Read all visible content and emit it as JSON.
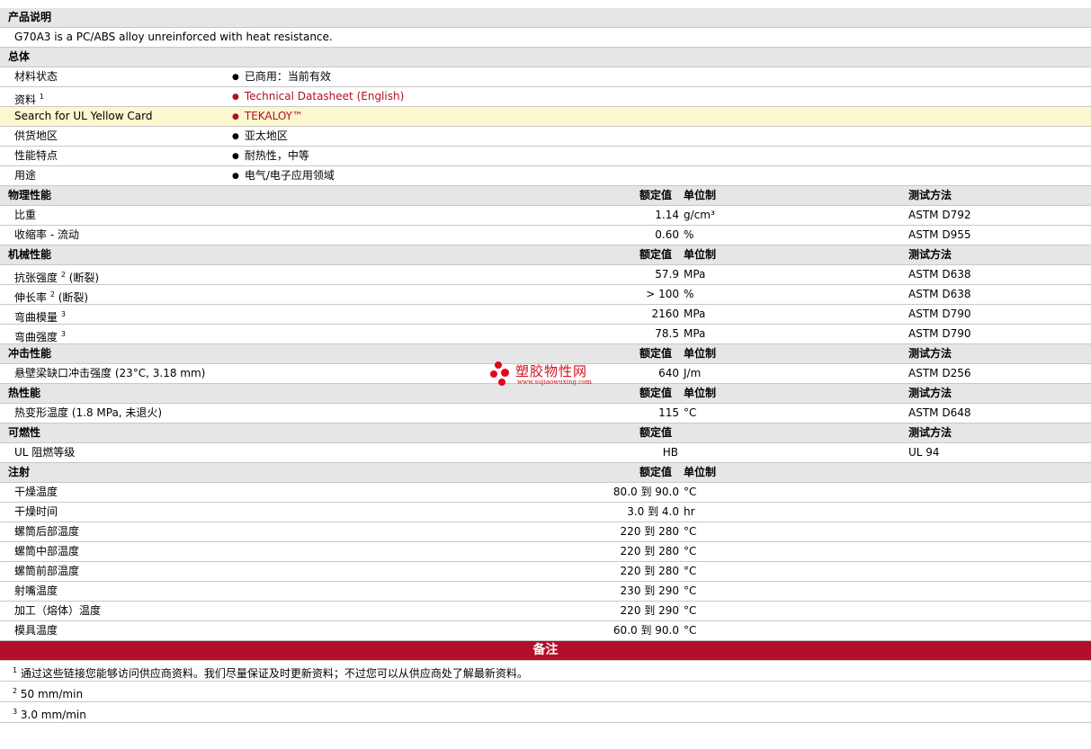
{
  "description": {
    "header": "产品说明",
    "text": "G70A3 is a PC/ABS alloy unreinforced with heat resistance."
  },
  "general": {
    "header": "总体",
    "rows": [
      {
        "label": "材料状态",
        "value": "已商用：当前有效",
        "link": false
      },
      {
        "label": "资料",
        "sup": "1",
        "value": "Technical Datasheet (English)",
        "link": true
      },
      {
        "label": "Search for UL Yellow Card",
        "value": "TEKALOY™",
        "link": true,
        "highlight": true
      },
      {
        "label": "供货地区",
        "value": "亚太地区",
        "link": false
      },
      {
        "label": "性能特点",
        "value": "耐热性，中等",
        "link": false
      },
      {
        "label": "用途",
        "value": "电气/电子应用领域",
        "link": false
      }
    ]
  },
  "col_headers": {
    "nominal": "额定值",
    "unit": "单位制",
    "method": "测试方法"
  },
  "physical": {
    "header": "物理性能",
    "rows": [
      {
        "label": "比重",
        "value": "1.14",
        "unit": "g/cm³",
        "method": "ASTM D792"
      },
      {
        "label": "收缩率  - 流动",
        "value": "0.60",
        "unit": "%",
        "method": "ASTM D955"
      }
    ]
  },
  "mechanical": {
    "header": "机械性能",
    "rows": [
      {
        "label": "抗张强度",
        "sup": "2",
        "suffix": "(断裂)",
        "value": "57.9",
        "unit": "MPa",
        "method": "ASTM D638"
      },
      {
        "label": "伸长率",
        "sup": "2",
        "suffix": "(断裂)",
        "value": "> 100",
        "unit": "%",
        "method": "ASTM D638"
      },
      {
        "label": "弯曲模量",
        "sup": "3",
        "suffix": "",
        "value": "2160",
        "unit": "MPa",
        "method": "ASTM D790"
      },
      {
        "label": "弯曲强度",
        "sup": "3",
        "suffix": "",
        "value": "78.5",
        "unit": "MPa",
        "method": "ASTM D790"
      }
    ]
  },
  "impact": {
    "header": "冲击性能",
    "rows": [
      {
        "label": "悬壁梁缺口冲击强度  (23°C, 3.18 mm)",
        "value": "640",
        "unit": "J/m",
        "method": "ASTM D256"
      }
    ]
  },
  "thermal": {
    "header": "热性能",
    "rows": [
      {
        "label": "热变形温度  (1.8 MPa, 未退火)",
        "value": "115",
        "unit": "°C",
        "method": "ASTM D648"
      }
    ]
  },
  "flammability": {
    "header": "可燃性",
    "rows": [
      {
        "label": "UL 阻燃等级",
        "value": "HB",
        "unit": "",
        "method": "UL 94"
      }
    ]
  },
  "injection": {
    "header": "注射",
    "to": "到",
    "rows": [
      {
        "label": "干燥温度",
        "from": "80.0",
        "upto": "90.0",
        "unit": "°C"
      },
      {
        "label": "干燥时间",
        "from": "3.0",
        "upto": "4.0",
        "unit": "hr"
      },
      {
        "label": "螺筒后部温度",
        "from": "220",
        "upto": "280",
        "unit": "°C"
      },
      {
        "label": "螺筒中部温度",
        "from": "220",
        "upto": "280",
        "unit": "°C"
      },
      {
        "label": "螺筒前部温度",
        "from": "220",
        "upto": "280",
        "unit": "°C"
      },
      {
        "label": "射嘴温度",
        "from": "230",
        "upto": "290",
        "unit": "°C"
      },
      {
        "label": "加工（熔体）温度",
        "from": "220",
        "upto": "290",
        "unit": "°C"
      },
      {
        "label": "模具温度",
        "from": "60.0",
        "upto": "90.0",
        "unit": "°C"
      }
    ]
  },
  "notes": {
    "header": "备注",
    "items": [
      {
        "num": "1",
        "text": "通过这些链接您能够访问供应商资料。我们尽量保证及时更新资料；不过您可以从供应商处了解最新资料。"
      },
      {
        "num": "2",
        "text": "50 mm/min"
      },
      {
        "num": "3",
        "text": "3.0 mm/min"
      }
    ]
  },
  "watermark": {
    "name": "塑胶物性网",
    "url": "www.sujiaowuxing.com"
  },
  "colors": {
    "link": "#b01026",
    "notes_bar": "#b10f2a",
    "header_bg": "#e6e6e6",
    "highlight_bg": "#fbf7cf"
  }
}
